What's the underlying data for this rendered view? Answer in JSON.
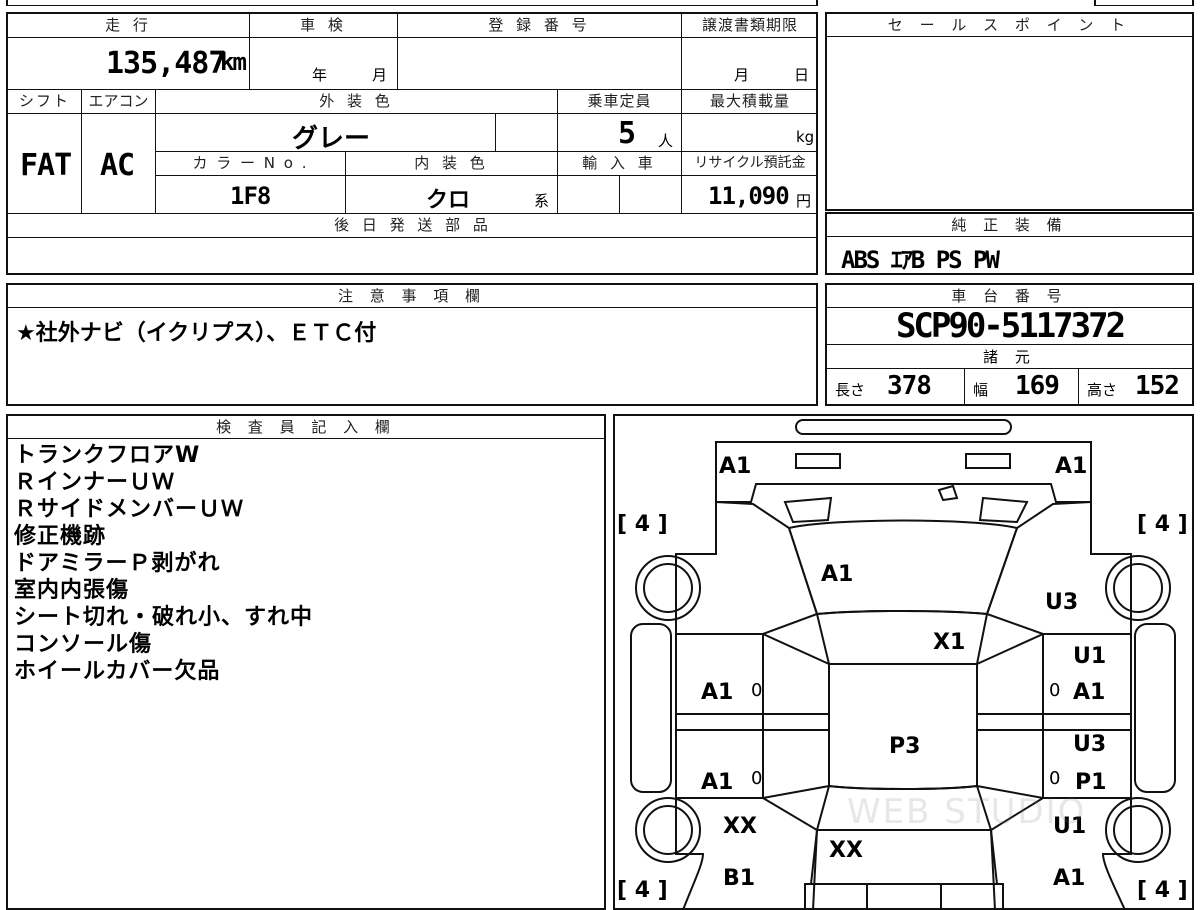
{
  "top_sheet": {
    "labels": {
      "mileage": "走 行",
      "inspection": "車 検",
      "registration": "登 録 番 号",
      "transfer_deadline": "譲渡書類期限",
      "shift": "シフト",
      "aircon": "エアコン",
      "exterior_color": "外 装 色",
      "capacity": "乗車定員",
      "max_load": "最大積載量",
      "color_no": "カ ラ ー N o .",
      "interior_color": "内 装 色",
      "import": "輸 入 車",
      "recycle": "リサイクル預託金",
      "later_parts": "後 日 発 送 部 品"
    },
    "mileage_value": "135,487",
    "mileage_unit": "km",
    "inspection_year_unit": "年",
    "inspection_month_unit": "月",
    "transfer_month_unit": "月",
    "transfer_day_unit": "日",
    "shift_value": "FAT",
    "aircon_value": "AC",
    "exterior_color_value": "グレー",
    "capacity_value": "5",
    "capacity_unit": "人",
    "max_load_unit": "kg",
    "color_no_value": "1F8",
    "interior_color_value": "クロ",
    "interior_suffix": "系",
    "recycle_value": "11,090",
    "recycle_unit": "円"
  },
  "sales_point": {
    "label": "セ ー ル ス ポ イ ン ト"
  },
  "genuine_equipment": {
    "label": "純 正 装 備",
    "value": "ABS ｴｱB PS PW"
  },
  "notes": {
    "label": "注 意 事 項 欄",
    "text": "★社外ナビ（イクリプス）、ＥＴＣ付"
  },
  "chassis": {
    "label": "車 台 番 号",
    "value": "SCP90-5117372"
  },
  "specs": {
    "label": "諸 元",
    "length_label": "長さ",
    "length_value": "378",
    "width_label": "幅",
    "width_value": "169",
    "height_label": "高さ",
    "height_value": "152"
  },
  "inspector": {
    "label": "検 査 員 記 入 欄",
    "lines": [
      "トランクフロアW",
      "ＲインナーＵＷ",
      "ＲサイドメンバーＵＷ",
      "修正機跡",
      "ドアミラーＰ剥がれ",
      "室内内張傷",
      "シート切れ・破れ小、すれ中",
      "コンソール傷",
      "ホイールカバー欠品"
    ]
  },
  "diagram": {
    "tires": [
      "[ 4 ]",
      "[ 4 ]",
      "[ 4 ]",
      "[ 4 ]"
    ],
    "marks": {
      "rear_left_top": "A1",
      "rear_right_top": "A1",
      "rear_glass": "A1",
      "right_quarter": "U3",
      "roof_right": "X1",
      "right_rear_door_top": "U1",
      "left_rear_door": "A1",
      "right_rear_door": "A1",
      "roof_center": "P3",
      "right_front_door_top": "U3",
      "left_front_door": "A1",
      "right_front_door": "P1",
      "left_fender": "XX",
      "hood": "XX",
      "right_fender": "U1",
      "front_left": "B1",
      "front_right": "A1"
    },
    "zero_marks": [
      "0",
      "0",
      "0",
      "0"
    ],
    "watermark": "WEB STUDIO"
  }
}
